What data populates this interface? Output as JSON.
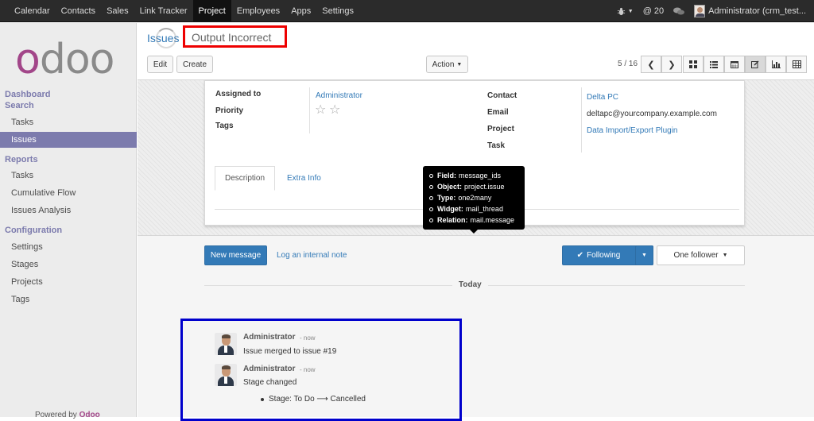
{
  "topbar": {
    "menu": [
      "Calendar",
      "Contacts",
      "Sales",
      "Link Tracker",
      "Project",
      "Employees",
      "Apps",
      "Settings"
    ],
    "active": "Project",
    "message_count": "20",
    "user": "Administrator (crm_test..."
  },
  "sidebar": {
    "logo": "odoo",
    "sections": [
      {
        "title": "Dashboard"
      },
      {
        "title": "Search",
        "items": [
          "Tasks",
          "Issues"
        ]
      },
      {
        "title": "Reports",
        "items": [
          "Tasks",
          "Cumulative Flow",
          "Issues Analysis"
        ]
      },
      {
        "title": "Configuration",
        "items": [
          "Settings",
          "Stages",
          "Projects",
          "Tags"
        ]
      }
    ],
    "active_item": "Issues",
    "powered_prefix": "Powered by",
    "powered_brand": "Odoo"
  },
  "header": {
    "breadcrumb": "Issues",
    "title": "Output Incorrect",
    "edit": "Edit",
    "create": "Create",
    "action": "Action",
    "pager": "5 / 16"
  },
  "form": {
    "assigned_to_label": "Assigned to",
    "assigned_to": "Administrator",
    "priority_label": "Priority",
    "priority_stars": 0,
    "tags_label": "Tags",
    "contact_label": "Contact",
    "contact": "Delta PC",
    "email_label": "Email",
    "email": "deltapc@yourcompany.example.com",
    "project_label": "Project",
    "project": "Data Import/Export Plugin",
    "task_label": "Task",
    "tabs": [
      "Description",
      "Extra Info"
    ]
  },
  "tooltip": [
    {
      "k": "Field:",
      "v": "message_ids"
    },
    {
      "k": "Object:",
      "v": "project.issue"
    },
    {
      "k": "Type:",
      "v": "one2many"
    },
    {
      "k": "Widget:",
      "v": "mail_thread"
    },
    {
      "k": "Relation:",
      "v": "mail.message"
    }
  ],
  "chatter": {
    "new_message": "New message",
    "log_note": "Log an internal note",
    "following": "Following",
    "followers": "One follower",
    "today": "Today",
    "messages": [
      {
        "author": "Administrator",
        "when": "- now",
        "body": "Issue merged to issue #19"
      },
      {
        "author": "Administrator",
        "when": "- now",
        "body": "Stage changed",
        "tracking": "Stage: To Do ⟶ Cancelled"
      }
    ]
  },
  "colors": {
    "brand": "#a24689",
    "sidebar_accent": "#7c7bad",
    "primary": "#337ab7",
    "annotation_red": "#e00000",
    "annotation_blue": "#0000cc"
  }
}
